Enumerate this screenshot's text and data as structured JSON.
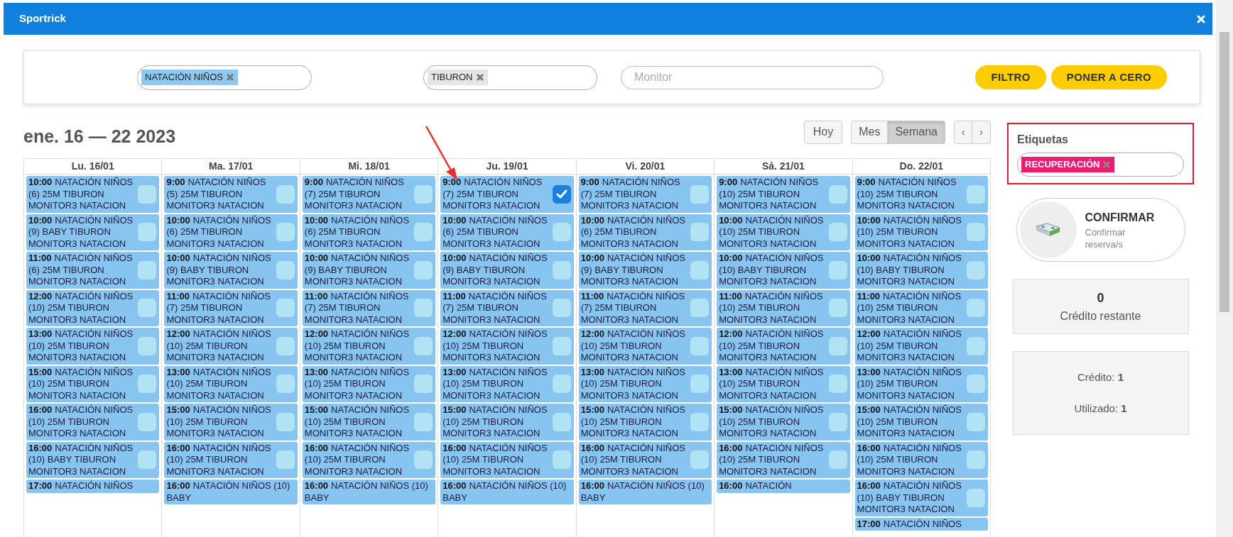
{
  "window": {
    "title": "Sportrick"
  },
  "filters": {
    "fields": [
      {
        "chips": [
          {
            "label": "NATACIÓN NIÑOS",
            "kind": "activity"
          }
        ]
      },
      {
        "chips": [
          {
            "label": "TIBURON",
            "kind": "level"
          }
        ]
      },
      {
        "placeholder": "Monitor"
      }
    ],
    "buttons": [
      "FILTRO",
      "PONER A CERO"
    ]
  },
  "calendar": {
    "title": "ene. 16 — 22 2023",
    "today_button": "Hoy",
    "views": [
      {
        "label": "Mes",
        "selected": false
      },
      {
        "label": "Semana",
        "selected": true
      }
    ],
    "prev": "‹",
    "next": "›",
    "days": [
      {
        "header": "Lu. 16/01",
        "events": [
          {
            "time": "10:00",
            "title": "NATACIÓN NIÑOS (6) 25M TIBURON MONITOR3 NATACION",
            "checked": false
          },
          {
            "time": "10:00",
            "title": "NATACIÓN NIÑOS (9) BABY TIBURON MONITOR3 NATACION",
            "checked": false
          },
          {
            "time": "11:00",
            "title": "NATACIÓN NIÑOS (6) 25M TIBURON MONITOR3 NATACION",
            "checked": false
          },
          {
            "time": "12:00",
            "title": "NATACIÓN NIÑOS (10) 25M TIBURON MONITOR3 NATACION",
            "checked": false
          },
          {
            "time": "13:00",
            "title": "NATACIÓN NIÑOS (10) 25M TIBURON MONITOR3 NATACION",
            "checked": false
          },
          {
            "time": "15:00",
            "title": "NATACIÓN NIÑOS (10) 25M TIBURON MONITOR3 NATACION",
            "checked": false
          },
          {
            "time": "16:00",
            "title": "NATACIÓN NIÑOS (10) 25M TIBURON MONITOR3 NATACION",
            "checked": false
          },
          {
            "time": "16:00",
            "title": "NATACIÓN NIÑOS (10) BABY TIBURON MONITOR3 NATACION",
            "checked": false
          },
          {
            "time": "17:00",
            "title": "NATACIÓN NIÑOS"
          }
        ]
      },
      {
        "header": "Ma. 17/01",
        "events": [
          {
            "time": "9:00",
            "title": "NATACIÓN NIÑOS (5) 25M TIBURON MONITOR3 NATACION",
            "checked": false
          },
          {
            "time": "10:00",
            "title": "NATACIÓN NIÑOS (6) 25M TIBURON MONITOR3 NATACION",
            "checked": false
          },
          {
            "time": "10:00",
            "title": "NATACIÓN NIÑOS (9) BABY TIBURON MONITOR3 NATACION",
            "checked": false
          },
          {
            "time": "11:00",
            "title": "NATACIÓN NIÑOS (7) 25M TIBURON MONITOR3 NATACION",
            "checked": false
          },
          {
            "time": "12:00",
            "title": "NATACIÓN NIÑOS (10) 25M TIBURON MONITOR3 NATACION",
            "checked": false
          },
          {
            "time": "13:00",
            "title": "NATACIÓN NIÑOS (10) 25M TIBURON MONITOR3 NATACION",
            "checked": false
          },
          {
            "time": "15:00",
            "title": "NATACIÓN NIÑOS (10) 25M TIBURON MONITOR3 NATACION",
            "checked": false
          },
          {
            "time": "16:00",
            "title": "NATACIÓN NIÑOS (10) 25M TIBURON MONITOR3 NATACION",
            "checked": false
          },
          {
            "time": "16:00",
            "title": "NATACIÓN NIÑOS (10) BABY"
          }
        ]
      },
      {
        "header": "Mi. 18/01",
        "events": [
          {
            "time": "9:00",
            "title": "NATACIÓN NIÑOS (7) 25M TIBURON MONITOR3 NATACION",
            "checked": false
          },
          {
            "time": "10:00",
            "title": "NATACIÓN NIÑOS (6) 25M TIBURON MONITOR3 NATACION",
            "checked": false
          },
          {
            "time": "10:00",
            "title": "NATACIÓN NIÑOS (9) BABY TIBURON MONITOR3 NATACION",
            "checked": false
          },
          {
            "time": "11:00",
            "title": "NATACIÓN NIÑOS (7) 25M TIBURON MONITOR3 NATACION",
            "checked": false
          },
          {
            "time": "12:00",
            "title": "NATACIÓN NIÑOS (10) 25M TIBURON MONITOR3 NATACION",
            "checked": false
          },
          {
            "time": "13:00",
            "title": "NATACIÓN NIÑOS (10) 25M TIBURON MONITOR3 NATACION",
            "checked": false
          },
          {
            "time": "15:00",
            "title": "NATACIÓN NIÑOS (10) 25M TIBURON MONITOR3 NATACION",
            "checked": false
          },
          {
            "time": "16:00",
            "title": "NATACIÓN NIÑOS (10) 25M TIBURON MONITOR3 NATACION",
            "checked": false
          },
          {
            "time": "16:00",
            "title": "NATACIÓN NIÑOS (10) BABY"
          }
        ]
      },
      {
        "header": "Ju. 19/01",
        "events": [
          {
            "time": "9:00",
            "title": "NATACIÓN NIÑOS (7) 25M TIBURON MONITOR3 NATACION",
            "checked": true
          },
          {
            "time": "10:00",
            "title": "NATACIÓN NIÑOS (6) 25M TIBURON MONITOR3 NATACION",
            "checked": false
          },
          {
            "time": "10:00",
            "title": "NATACIÓN NIÑOS (9) BABY TIBURON MONITOR3 NATACION",
            "checked": false
          },
          {
            "time": "11:00",
            "title": "NATACIÓN NIÑOS (7) 25M TIBURON MONITOR3 NATACION",
            "checked": false
          },
          {
            "time": "12:00",
            "title": "NATACIÓN NIÑOS (10) 25M TIBURON MONITOR3 NATACION",
            "checked": false
          },
          {
            "time": "13:00",
            "title": "NATACIÓN NIÑOS (10) 25M TIBURON MONITOR3 NATACION",
            "checked": false
          },
          {
            "time": "15:00",
            "title": "NATACIÓN NIÑOS (10) 25M TIBURON MONITOR3 NATACION",
            "checked": false
          },
          {
            "time": "16:00",
            "title": "NATACIÓN NIÑOS (10) 25M TIBURON MONITOR3 NATACION",
            "checked": false
          },
          {
            "time": "16:00",
            "title": "NATACIÓN NIÑOS (10) BABY"
          }
        ]
      },
      {
        "header": "Vi. 20/01",
        "events": [
          {
            "time": "9:00",
            "title": "NATACIÓN NIÑOS (7) 25M TIBURON MONITOR3 NATACION",
            "checked": false
          },
          {
            "time": "10:00",
            "title": "NATACIÓN NIÑOS (6) 25M TIBURON MONITOR3 NATACION",
            "checked": false
          },
          {
            "time": "10:00",
            "title": "NATACIÓN NIÑOS (9) BABY TIBURON MONITOR3 NATACION",
            "checked": false
          },
          {
            "time": "11:00",
            "title": "NATACIÓN NIÑOS (7) 25M TIBURON MONITOR3 NATACION",
            "checked": false
          },
          {
            "time": "12:00",
            "title": "NATACIÓN NIÑOS (10) 25M TIBURON MONITOR3 NATACION",
            "checked": false
          },
          {
            "time": "13:00",
            "title": "NATACIÓN NIÑOS (10) 25M TIBURON MONITOR3 NATACION",
            "checked": false
          },
          {
            "time": "15:00",
            "title": "NATACIÓN NIÑOS (10) 25M TIBURON MONITOR3 NATACION",
            "checked": false
          },
          {
            "time": "16:00",
            "title": "NATACIÓN NIÑOS (10) 25M TIBURON MONITOR3 NATACION",
            "checked": false
          },
          {
            "time": "16:00",
            "title": "NATACIÓN NIÑOS (10) BABY"
          }
        ]
      },
      {
        "header": "Sá. 21/01",
        "events": [
          {
            "time": "9:00",
            "title": "NATACIÓN NIÑOS (10) 25M TIBURON MONITOR3 NATACION",
            "checked": false
          },
          {
            "time": "10:00",
            "title": "NATACIÓN NIÑOS (10) 25M TIBURON MONITOR3 NATACION",
            "checked": false
          },
          {
            "time": "10:00",
            "title": "NATACIÓN NIÑOS (10) BABY TIBURON MONITOR3 NATACION",
            "checked": false
          },
          {
            "time": "11:00",
            "title": "NATACIÓN NIÑOS (10) 25M TIBURON MONITOR3 NATACION",
            "checked": false
          },
          {
            "time": "12:00",
            "title": "NATACIÓN NIÑOS (10) 25M TIBURON MONITOR3 NATACION",
            "checked": false
          },
          {
            "time": "13:00",
            "title": "NATACIÓN NIÑOS (10) 25M TIBURON MONITOR3 NATACION",
            "checked": false
          },
          {
            "time": "15:00",
            "title": "NATACIÓN NIÑOS (10) 25M TIBURON MONITOR3 NATACION",
            "checked": false
          },
          {
            "time": "16:00",
            "title": "NATACIÓN NIÑOS (10) 25M TIBURON MONITOR3 NATACION",
            "checked": false
          },
          {
            "time": "16:00",
            "title": "NATACIÓN"
          }
        ]
      },
      {
        "header": "Do. 22/01",
        "events": [
          {
            "time": "9:00",
            "title": "NATACIÓN NIÑOS (10) 25M TIBURON MONITOR3 NATACION",
            "checked": false
          },
          {
            "time": "10:00",
            "title": "NATACIÓN NIÑOS (10) 25M TIBURON MONITOR3 NATACION",
            "checked": false
          },
          {
            "time": "10:00",
            "title": "NATACIÓN NIÑOS (10) BABY TIBURON MONITOR3 NATACION",
            "checked": false
          },
          {
            "time": "11:00",
            "title": "NATACIÓN NIÑOS (10) 25M TIBURON MONITOR3 NATACION",
            "checked": false
          },
          {
            "time": "12:00",
            "title": "NATACIÓN NIÑOS (10) 25M TIBURON MONITOR3 NATACION",
            "checked": false
          },
          {
            "time": "13:00",
            "title": "NATACIÓN NIÑOS (10) 25M TIBURON MONITOR3 NATACION",
            "checked": false
          },
          {
            "time": "15:00",
            "title": "NATACIÓN NIÑOS (10) 25M TIBURON MONITOR3 NATACION",
            "checked": false
          },
          {
            "time": "16:00",
            "title": "NATACIÓN NIÑOS (10) 25M TIBURON MONITOR3 NATACION",
            "checked": false
          },
          {
            "time": "16:00",
            "title": "NATACIÓN NIÑOS (10) BABY TIBURON MONITOR3 NATACION",
            "checked": false
          },
          {
            "time": "17:00",
            "title": "NATACIÓN NIÑOS"
          }
        ]
      }
    ]
  },
  "tags": {
    "label": "Etiquetas",
    "chips": [
      {
        "label": "RECUPERACIÓN"
      }
    ]
  },
  "confirm": {
    "title": "CONFIRMAR",
    "subtitle": "Confirmar reserva/s"
  },
  "credit_remaining": {
    "value": "0",
    "label": "Crédito restante"
  },
  "credit_summary": [
    "Crédito: **1**",
    "Utilizado: **1**"
  ]
}
